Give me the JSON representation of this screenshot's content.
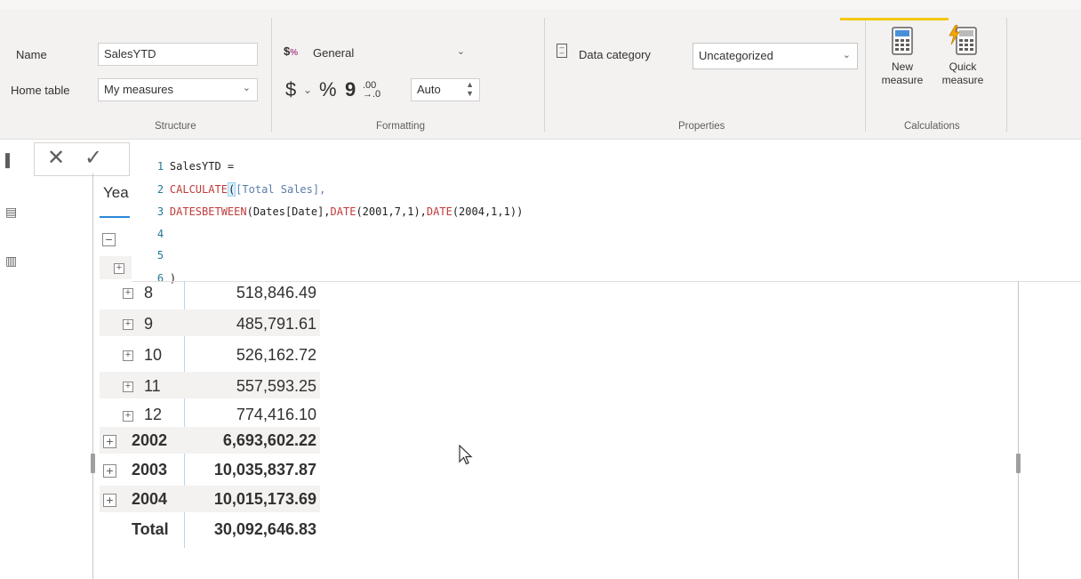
{
  "ribbon": {
    "structure": {
      "name_label": "Name",
      "name_value": "SalesYTD",
      "home_table_label": "Home table",
      "home_table_value": "My measures",
      "group_label": "Structure"
    },
    "formatting": {
      "format_value": "General",
      "currency_symbol": "$",
      "percent_symbol": "%",
      "comma_symbol": "9",
      "decimals_value": "Auto",
      "group_label": "Formatting"
    },
    "properties": {
      "data_category_label": "Data category",
      "data_category_value": "Uncategorized",
      "group_label": "Properties"
    },
    "calculations": {
      "new_measure_line1": "New",
      "new_measure_line2": "measure",
      "quick_measure_line1": "Quick",
      "quick_measure_line2": "measure",
      "group_label": "Calculations"
    }
  },
  "formula": {
    "lines": [
      {
        "num": "1",
        "text": "SalesYTD ="
      },
      {
        "num": "2",
        "fn": "CALCULATE",
        "paren": "(",
        "text": "[Total Sales],"
      },
      {
        "num": "3",
        "fn": "DATESBETWEEN",
        "text": "(Dates[Date],",
        "fn2": "DATE",
        "text2": "(2001,7,1),",
        "fn3": "DATE",
        "text3": "(2004,1,1))"
      },
      {
        "num": "4",
        "text": ""
      },
      {
        "num": "5",
        "text": ""
      },
      {
        "num": "6",
        "text": ")"
      }
    ]
  },
  "matrix": {
    "header": "Yea",
    "rows": [
      {
        "label": "8",
        "value": "518,846.49",
        "bold": false
      },
      {
        "label": "9",
        "value": "485,791.61",
        "bold": false
      },
      {
        "label": "10",
        "value": "526,162.72",
        "bold": false
      },
      {
        "label": "11",
        "value": "557,593.25",
        "bold": false
      },
      {
        "label": "12",
        "value": "774,416.10",
        "bold": false
      },
      {
        "label": "2002",
        "value": "6,693,602.22",
        "bold": true
      },
      {
        "label": "2003",
        "value": "10,035,837.87",
        "bold": true
      },
      {
        "label": "2004",
        "value": "10,015,173.69",
        "bold": true
      }
    ],
    "total": {
      "label": "Total",
      "value": "30,092,646.83"
    }
  },
  "icons": {
    "cancel": "✕",
    "commit": "✓",
    "expand": "+",
    "collapse": "−",
    "dropdown": "⌄"
  }
}
